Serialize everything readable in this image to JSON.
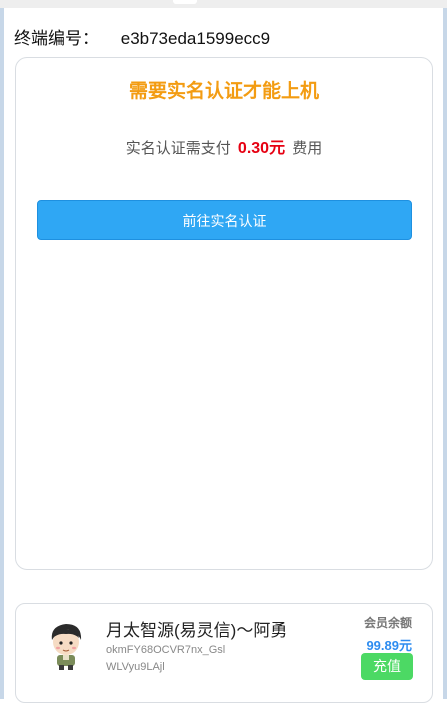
{
  "terminal": {
    "label": "终端编号：",
    "id": "e3b73eda1599ecc9"
  },
  "verification": {
    "title": "需要实名认证才能上机",
    "desc_prefix": "实名认证需支付",
    "amount": "0.30元",
    "desc_suffix": "费用",
    "button_label": "前往实名认证",
    "title_color": "#f39c12",
    "amount_color": "#e60012",
    "button_color": "#2fa7f4"
  },
  "user": {
    "name": "月太智源(易灵信)～阿勇",
    "account_id": "okmFY68OCVR7nx_GslWLVyu9LAjl",
    "balance_label": "会员余额",
    "balance_value": "99.89元",
    "recharge_label": "充值",
    "avatar_icon": "cartoon-user-avatar",
    "balance_color": "#2d8cf0",
    "recharge_color": "#4cd964"
  }
}
